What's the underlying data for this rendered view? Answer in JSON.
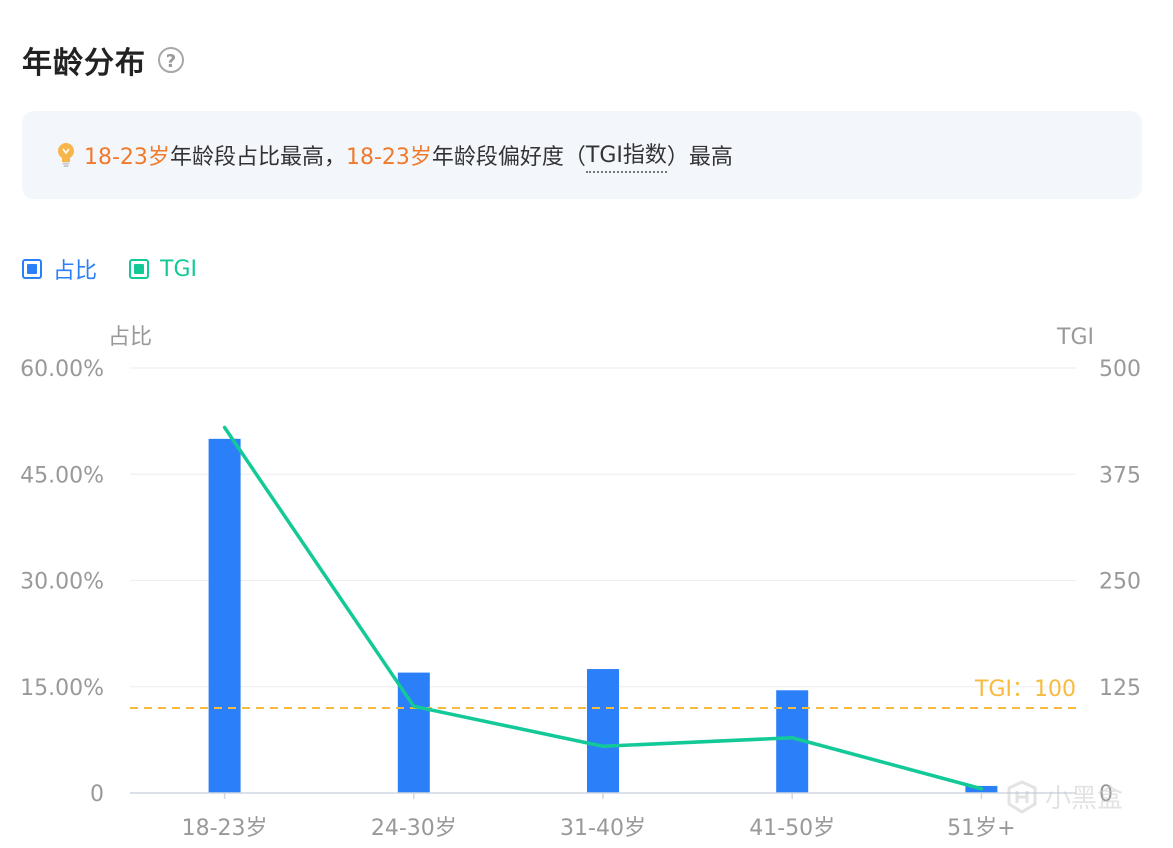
{
  "header": {
    "title": "年龄分布",
    "help_icon": "question-circle-icon"
  },
  "insight": {
    "icon": "lightbulb-icon",
    "part1_highlight": "18-23岁",
    "part2": "年龄段占比最高，",
    "part3_highlight": "18-23岁",
    "part4": "年龄段偏好度（",
    "part5_dotted": "TGI指数",
    "part6": "）最高"
  },
  "legend": [
    {
      "label": "占比",
      "color": "#2b7ff9"
    },
    {
      "label": "TGI",
      "color": "#13c998"
    }
  ],
  "colors": {
    "bar": "#2b7ff9",
    "line": "#13c998",
    "reference": "#f8bb3d",
    "axis_text": "#999999",
    "accent_orange": "#f07a2b"
  },
  "chart_data": {
    "type": "bar",
    "categories": [
      "18-23岁",
      "24-30岁",
      "31-40岁",
      "41-50岁",
      "51岁+"
    ],
    "series": [
      {
        "name": "占比",
        "type": "bar",
        "axis": "left",
        "values": [
          50.0,
          17.0,
          17.5,
          14.5,
          1.0
        ]
      },
      {
        "name": "TGI",
        "type": "line",
        "axis": "right",
        "values": [
          430,
          102,
          55,
          65,
          5
        ]
      }
    ],
    "left_axis": {
      "label": "占比",
      "ylim": [
        0,
        60
      ],
      "ticks": [
        0,
        15,
        30,
        45,
        60
      ],
      "tick_labels": [
        "0",
        "15.00%",
        "30.00%",
        "45.00%",
        "60.00%"
      ]
    },
    "right_axis": {
      "label": "TGI",
      "ylim": [
        0,
        500
      ],
      "ticks": [
        0,
        125,
        250,
        375,
        500
      ],
      "tick_labels": [
        "0",
        "125",
        "250",
        "375",
        "500"
      ]
    },
    "reference_line": {
      "axis": "right",
      "value": 100,
      "label": "TGI：100"
    },
    "grid": true,
    "legend_position": "top-left"
  },
  "watermark": {
    "text": "小黑盒",
    "icon": "heybox-logo-icon"
  }
}
